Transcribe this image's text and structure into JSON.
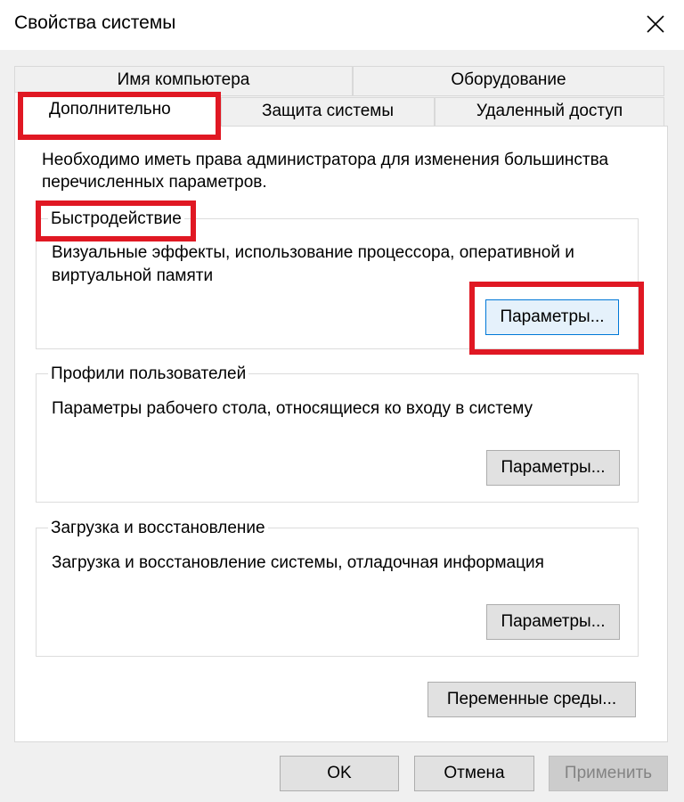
{
  "window": {
    "title": "Свойства системы",
    "close_icon": "close-icon"
  },
  "tabs": {
    "computer_name": "Имя компьютера",
    "hardware": "Оборудование",
    "advanced": "Дополнительно",
    "system_protection": "Защита системы",
    "remote_access": "Удаленный доступ",
    "active": "advanced"
  },
  "advanced": {
    "admin_note_line1": "Необходимо иметь права администратора для изменения большинства",
    "admin_note_line2": "перечисленных параметров.",
    "performance": {
      "title": "Быстродействие",
      "desc_line1": "Визуальные эффекты, использование процессора, оперативной и",
      "desc_line2": "виртуальной памяти",
      "button": "Параметры..."
    },
    "user_profiles": {
      "title": "Профили пользователей",
      "desc": "Параметры рабочего стола, относящиеся ко входу в систему",
      "button": "Параметры..."
    },
    "startup_recovery": {
      "title": "Загрузка и восстановление",
      "desc": "Загрузка и восстановление системы, отладочная информация",
      "button": "Параметры..."
    },
    "env_vars_button": "Переменные среды..."
  },
  "footer": {
    "ok": "OK",
    "cancel": "Отмена",
    "apply": "Применить"
  },
  "colors": {
    "highlight": "#e01823",
    "dialog_bg": "#f0f0f0",
    "focus_border": "#0078d7"
  }
}
